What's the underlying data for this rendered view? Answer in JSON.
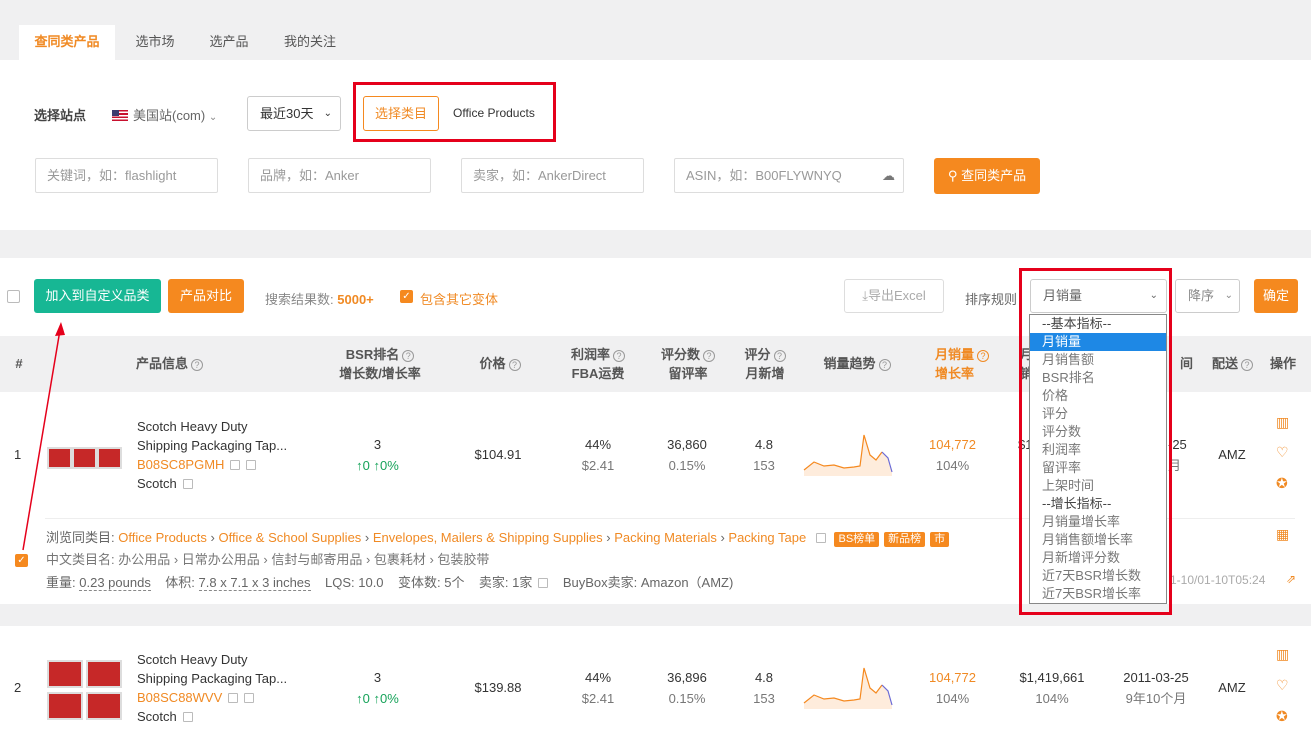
{
  "tabs": [
    "查同类产品",
    "选市场",
    "选产品",
    "我的关注"
  ],
  "filters": {
    "site_label": "选择站点",
    "site_value": "美国站(com)",
    "period": "最近30天",
    "category_button": "选择类目",
    "category_value": "Office Products",
    "keyword_ph": "关键词，如：flashlight",
    "brand_ph": "品牌，如：Anker",
    "seller_ph": "卖家，如：AnkerDirect",
    "asin_ph": "ASIN，如：B00FLYWNYQ",
    "search_button": "查同类产品"
  },
  "toolbar": {
    "add_custom": "加入到自定义品类",
    "compare": "产品对比",
    "result_label": "搜索结果数:",
    "result_count": "5000+",
    "include_variants": "包含其它变体",
    "export": "导出Excel",
    "sort_label": "排序规则",
    "sort_value": "月销量",
    "order_value": "降序",
    "confirm": "确定"
  },
  "headers": {
    "num": "#",
    "info": "产品信息",
    "bsr": "BSR排名",
    "bsr_sub": "增长数/增长率",
    "price": "价格",
    "margin": "利润率",
    "margin_sub": "FBA运费",
    "reviews": "评分数",
    "reviews_sub": "留评率",
    "rating": "评分",
    "rating_sub": "月新增",
    "trend": "销量趋势",
    "monthly": "月销量",
    "monthly_sub": "增长率",
    "sales_frag": "月",
    "sales_frag2": "销",
    "date_frag": "间",
    "ship": "配送",
    "ops": "操作"
  },
  "sort_options": [
    "--基本指标--",
    "月销量",
    "月销售额",
    "BSR排名",
    "价格",
    "评分",
    "评分数",
    "利润率",
    "留评率",
    "上架时间",
    "--增长指标--",
    "月销量增长率",
    "月销售额增长率",
    "月新增评分数",
    "近7天BSR增长数",
    "近7天BSR增长率"
  ],
  "rows": [
    {
      "num": "1",
      "title1": "Scotch Heavy Duty",
      "title2": "Shipping Packaging Tap...",
      "asin": "B08SC8PGMH",
      "brand": "Scotch",
      "bsr": "3",
      "bsr_growth": "↑0  ↑0%",
      "price": "$104.91",
      "margin": "44%",
      "fba": "$2.41",
      "reviews": "36,860",
      "review_rate": "0.15%",
      "rating": "4.8",
      "rating_new": "153",
      "monthly": "104,772",
      "monthly_rate": "104%",
      "sales_frag": "$1",
      "date": "-25",
      "date_sub": "月",
      "ship": "AMZ"
    },
    {
      "num": "2",
      "title1": "Scotch Heavy Duty",
      "title2": "Shipping Packaging Tap...",
      "asin": "B08SC88WVV",
      "brand": "Scotch",
      "bsr": "3",
      "bsr_growth": "↑0  ↑0%",
      "price": "$139.88",
      "margin": "44%",
      "fba": "$2.41",
      "reviews": "36,896",
      "review_rate": "0.15%",
      "rating": "4.8",
      "rating_new": "153",
      "monthly": "104,772",
      "monthly_rate": "104%",
      "sales": "$1,419,661",
      "sales_rate": "104%",
      "date": "2011-03-25",
      "date_sub": "9年10个月",
      "ship": "AMZ"
    }
  ],
  "detail": {
    "browse_label": "浏览同类目:",
    "path": [
      "Office Products",
      "Office & School Supplies",
      "Envelopes, Mailers & Shipping Supplies",
      "Packing Materials",
      "Packing Tape"
    ],
    "tag1": "BS榜单",
    "tag2": "新品榜",
    "tag3": "市",
    "cn_path": "中文类目名: 办公用品 › 日常办公用品 › 信封与邮寄用品 › 包裹耗材 › 包装胶带",
    "weight_label": "重量:",
    "weight": "0.23 pounds",
    "volume_label": "体积:",
    "volume": "7.8 x 7.1 x 3 inches",
    "lqs": "LQS: 10.0",
    "variants": "变体数: 5个",
    "sellers": "卖家: 1家",
    "buybox": "BuyBox卖家: Amazon（AMZ)",
    "time_frag": "1-10/01-10T05:24"
  },
  "colors": {
    "accent": "#f5891f",
    "green": "#17b794",
    "highlight": "#e5001b"
  }
}
